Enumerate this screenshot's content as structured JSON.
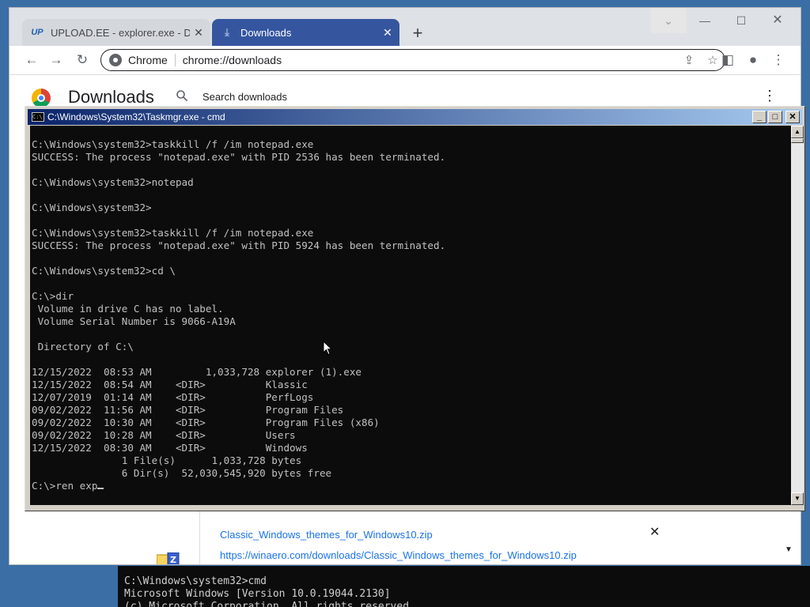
{
  "background_console": {
    "lines": "C:\\Windows\\system32>cmd\nMicrosoft Windows [Version 10.0.19044.2130]\n(c) Microsoft Corporation. All rights reserved."
  },
  "browser": {
    "tabs": [
      {
        "favicon": "UP",
        "title": "UPLOAD.EE - explorer.exe - Dow",
        "close": "✕"
      },
      {
        "favicon": "⤓",
        "title": "Downloads",
        "close": "✕"
      }
    ],
    "new_tab": "+",
    "window_controls": {
      "dropdown": "⌄",
      "minimize": "—",
      "maximize": "☐",
      "close": "✕"
    },
    "toolbar": {
      "back": "←",
      "forward": "→",
      "reload": "↻",
      "chip_label": "Chrome",
      "url": "chrome://downloads",
      "share": "⇪",
      "bookmark": "☆",
      "side_panel": "◧",
      "profile": "●",
      "menu": "⋮"
    },
    "downloads_page": {
      "title": "Downloads",
      "search_placeholder": "Search downloads",
      "more": "⋮",
      "item": {
        "file_name": "Classic_Windows_themes_for_Windows10.zip",
        "url": "https://winaero.com/downloads/Classic_Windows_themes_for_Windows10.zip",
        "close": "✕"
      },
      "scroll_indicator": "▼"
    }
  },
  "cmd_window": {
    "title": "C:\\Windows\\System32\\Taskmgr.exe - cmd",
    "buttons": {
      "minimize": "_",
      "maximize": "□",
      "close": "✕"
    },
    "output": "\nC:\\Windows\\system32>taskkill /f /im notepad.exe\nSUCCESS: The process \"notepad.exe\" with PID 2536 has been terminated.\n\nC:\\Windows\\system32>notepad\n\nC:\\Windows\\system32>\n\nC:\\Windows\\system32>taskkill /f /im notepad.exe\nSUCCESS: The process \"notepad.exe\" with PID 5924 has been terminated.\n\nC:\\Windows\\system32>cd \\\n\nC:\\>dir\n Volume in drive C has no label.\n Volume Serial Number is 9066-A19A\n\n Directory of C:\\\n\n12/15/2022  08:53 AM         1,033,728 explorer (1).exe\n12/15/2022  08:54 AM    <DIR>          Klassic\n12/07/2019  01:14 AM    <DIR>          PerfLogs\n09/02/2022  11:56 AM    <DIR>          Program Files\n09/02/2022  10:30 AM    <DIR>          Program Files (x86)\n09/02/2022  10:28 AM    <DIR>          Users\n12/15/2022  08:30 AM    <DIR>          Windows\n               1 File(s)      1,033,728 bytes\n               6 Dir(s)  52,030,545,920 bytes free\n",
    "prompt_input": "C:\\>ren exp"
  },
  "colors": {
    "desktop": "#3a6ea5",
    "active_tab": "#35569f",
    "link": "#1a73e8",
    "console_bg": "#0c0c0c",
    "console_text": "#c0c0c0"
  }
}
